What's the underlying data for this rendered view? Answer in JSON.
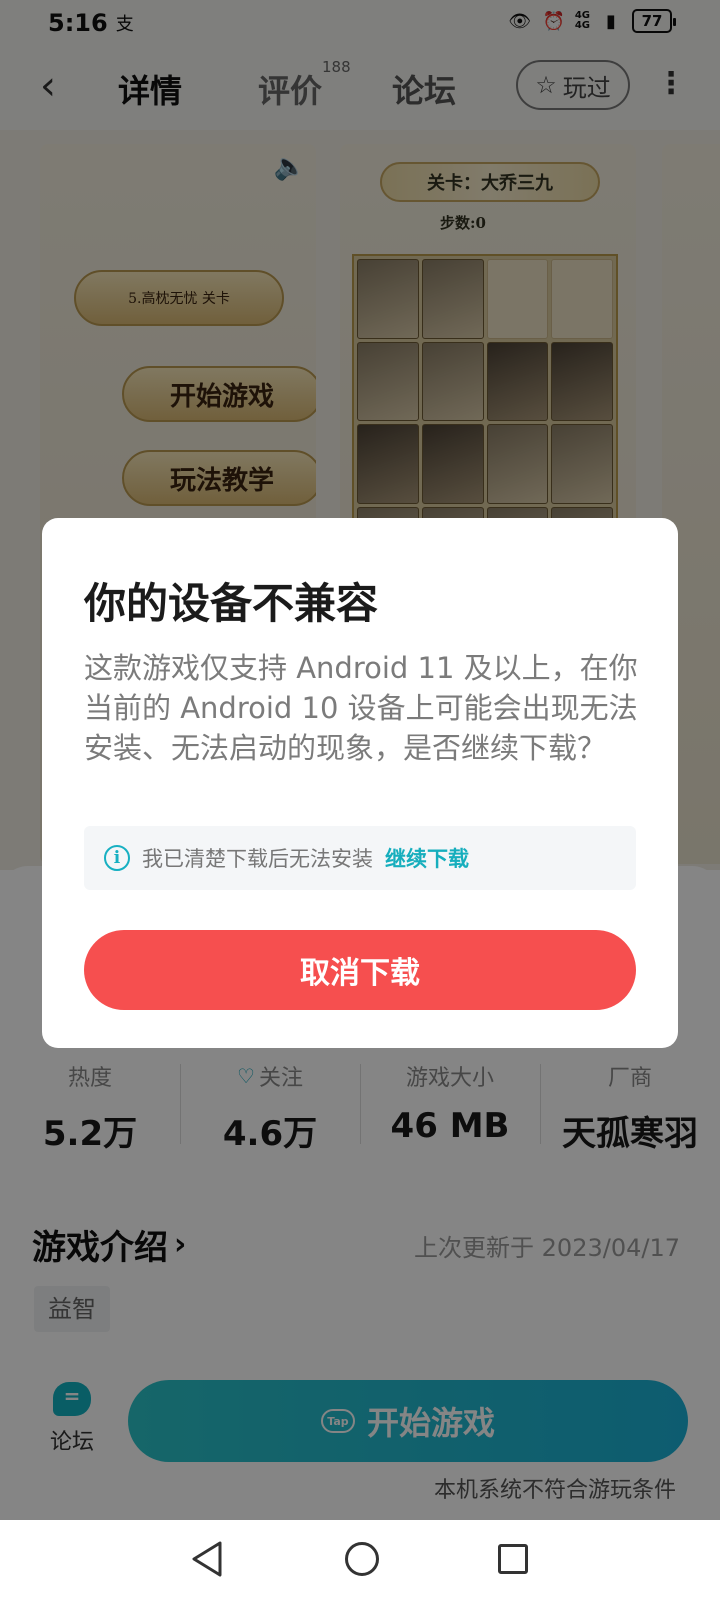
{
  "status_bar": {
    "time": "5:16",
    "app_glyph": "支",
    "network_top": "4G",
    "network_bottom": "4G",
    "battery": "77"
  },
  "nav": {
    "back_icon": "chevron-left-icon",
    "tabs": [
      {
        "label": "详情",
        "active": true
      },
      {
        "label": "评价",
        "badge": "188"
      },
      {
        "label": "论坛"
      }
    ],
    "played_label": "玩过",
    "more_icon": "more-vertical-icon"
  },
  "screenshots": {
    "shot1": {
      "level_label": "5.高枕无忧    关卡",
      "start_label": "开始游戏",
      "teach_label": "玩法教学"
    },
    "shot2": {
      "level_banner": "关卡：大乔三九",
      "steps": "步数:0"
    }
  },
  "stats": [
    {
      "label": "热度",
      "value": "5.2万"
    },
    {
      "label": "关注",
      "value": "4.6万"
    },
    {
      "label": "游戏大小",
      "value": "46 MB"
    },
    {
      "label": "厂商",
      "value": "天孤寒羽"
    }
  ],
  "intro": {
    "title": "游戏介绍",
    "updated": "上次更新于 2023/04/17",
    "tag": "益智"
  },
  "bottom_bar": {
    "forum_label": "论坛",
    "start_label": "开始游戏",
    "tap_logo": "Tap",
    "note": "本机系统不符合游玩条件"
  },
  "dialog": {
    "title": "你的设备不兼容",
    "body": "这款游戏仅支持 Android 11 及以上，在你当前的 Android 10 设备上可能会出现无法安装、无法启动的现象，是否继续下载？",
    "notice": "我已清楚下载后无法安装",
    "continue_link": "继续下载",
    "cancel_label": "取消下载"
  },
  "colors": {
    "accent": "#16aebd",
    "danger": "#f64f4f",
    "overlay": "rgba(0,0,0,0.48)"
  }
}
